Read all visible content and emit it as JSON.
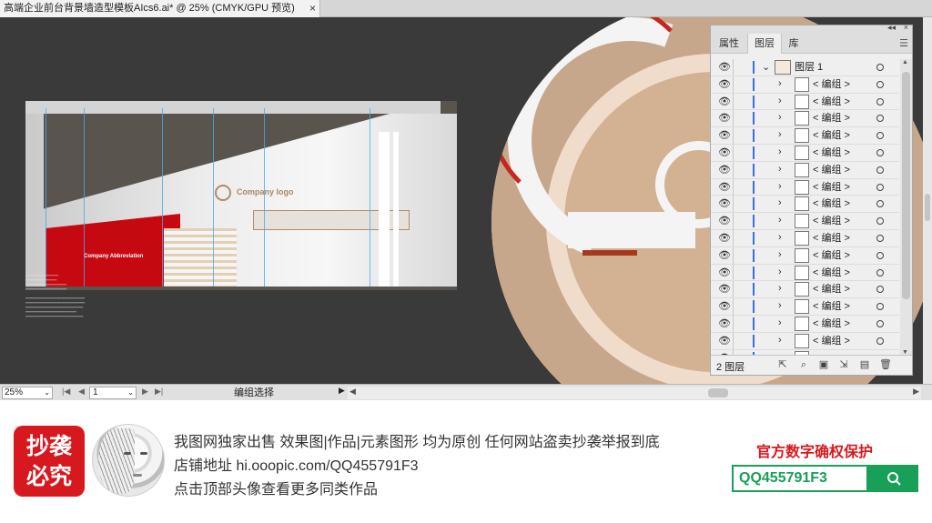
{
  "document_tab": {
    "title": "高端企业前台背景墙造型模板AIcs6.ai* @ 25% (CMYK/GPU 预览)",
    "close": "×"
  },
  "artwork": {
    "company_logo": "Company logo",
    "company_abbreviation": "Company Abbreviation"
  },
  "layers_panel": {
    "collapse": "◂◂",
    "close": "×",
    "tabs": [
      "属性",
      "图层",
      "库"
    ],
    "active_tab": "图层",
    "menu_icon": "hamburger-menu-icon",
    "top_layer": {
      "name": "图层 1",
      "expanded": true
    },
    "rows": [
      {
        "name": "< 编组 >"
      },
      {
        "name": "< 编组 >"
      },
      {
        "name": "< 编组 >"
      },
      {
        "name": "< 编组 >"
      },
      {
        "name": "< 编组 >"
      },
      {
        "name": "< 编组 >"
      },
      {
        "name": "< 编组 >"
      },
      {
        "name": "< 编组 >"
      },
      {
        "name": "< 编组 >"
      },
      {
        "name": "< 编组 >"
      },
      {
        "name": "< 编组 >"
      },
      {
        "name": "< 编组 >"
      },
      {
        "name": "< 编组 >"
      },
      {
        "name": "< 编组 >"
      },
      {
        "name": "< 编组 >"
      },
      {
        "name": "< 编组 >"
      },
      {
        "name": "<..."
      },
      {
        "name": "< 编组 >"
      }
    ],
    "footer": {
      "count": "2 图层",
      "tools": [
        "export-icon",
        "locate-search-icon",
        "clipping-mask-icon",
        "new-sublayer-icon",
        "new-layer-icon",
        "trash-icon"
      ]
    }
  },
  "statusbar": {
    "zoom": "25%",
    "page": "1",
    "tool_status": "编组选择"
  },
  "banner": {
    "stamp": "抄袭\n必究",
    "line1": "我图网独家出售 效果图|作品|元素图形 均为原创 任何网站盗卖抄袭举报到底",
    "line2": "店铺地址 hi.ooopic.com/QQ455791F3",
    "line3": "点击顶部头像查看更多同类作品",
    "protect_title": "官方数字确权保护",
    "qq": "QQ455791F3",
    "search_icon": "search-icon"
  }
}
